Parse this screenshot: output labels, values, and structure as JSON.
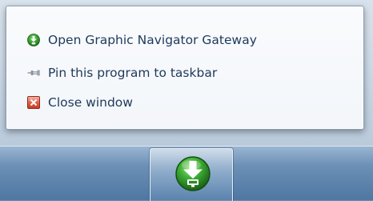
{
  "jumplist": {
    "items": [
      {
        "label": "Open Graphic Navigator Gateway",
        "icon": "green-download-app-icon"
      },
      {
        "label": "Pin this program to taskbar",
        "icon": "pin-icon"
      },
      {
        "label": "Close window",
        "icon": "close-window-icon"
      }
    ]
  },
  "taskbar": {
    "active_app_icon": "green-download-app-icon"
  },
  "colors": {
    "menu_text": "#1e395b",
    "app_icon_green": "#3aa232",
    "close_icon_red": "#e4614d"
  }
}
